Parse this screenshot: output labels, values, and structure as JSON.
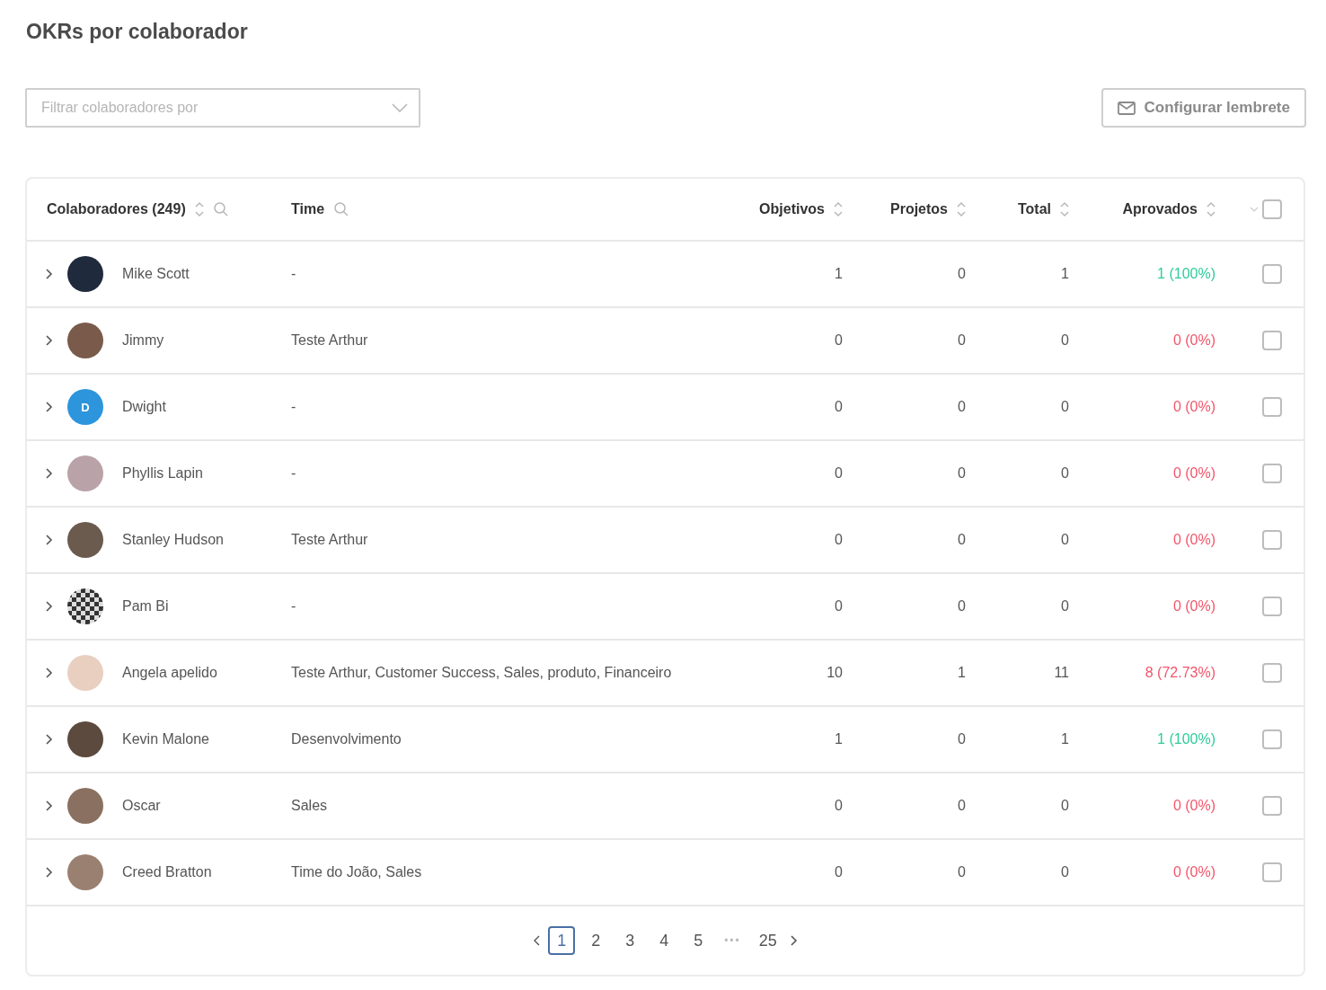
{
  "title": "OKRs por colaborador",
  "filter": {
    "placeholder": "Filtrar colaboradores por"
  },
  "reminder_button": {
    "label": "Configurar lembrete"
  },
  "table": {
    "columns": [
      {
        "label": "Colaboradores (249)",
        "sortable": true,
        "searchable": true
      },
      {
        "label": "Time",
        "sortable": false,
        "searchable": true
      },
      {
        "label": "Objetivos",
        "sortable": true,
        "searchable": false
      },
      {
        "label": "Projetos",
        "sortable": true,
        "searchable": false
      },
      {
        "label": "Total",
        "sortable": true,
        "searchable": false
      },
      {
        "label": "Aprovados",
        "sortable": true,
        "searchable": false
      }
    ],
    "select_all": {
      "checked": false
    },
    "rows": [
      {
        "name": "Mike Scott",
        "avatar": {
          "kind": "photo",
          "color": "#1f2a3c"
        },
        "team": "-",
        "objetivos": "1",
        "projetos": "0",
        "total": "1",
        "aprovados": "1 (100%)",
        "color": "#2ecc9a",
        "expanded": false,
        "checked": false
      },
      {
        "name": "Jimmy",
        "avatar": {
          "kind": "photo",
          "color": "#7a5a4a"
        },
        "team": "Teste Arthur",
        "objetivos": "0",
        "projetos": "0",
        "total": "0",
        "aprovados": "0 (0%)",
        "color": "#f2556a",
        "expanded": false,
        "checked": false
      },
      {
        "name": "Dwight",
        "avatar": {
          "kind": "initial",
          "color": "#2d95dc",
          "initial": "D"
        },
        "team": "-",
        "objetivos": "0",
        "projetos": "0",
        "total": "0",
        "aprovados": "0 (0%)",
        "color": "#f2556a",
        "expanded": false,
        "checked": false
      },
      {
        "name": "Phyllis Lapin",
        "avatar": {
          "kind": "photo",
          "color": "#b9a2a8"
        },
        "team": "-",
        "objetivos": "0",
        "projetos": "0",
        "total": "0",
        "aprovados": "0 (0%)",
        "color": "#f2556a",
        "expanded": false,
        "checked": false
      },
      {
        "name": "Stanley Hudson",
        "avatar": {
          "kind": "photo",
          "color": "#6b5a4e"
        },
        "team": "Teste Arthur",
        "objetivos": "0",
        "projetos": "0",
        "total": "0",
        "aprovados": "0 (0%)",
        "color": "#f2556a",
        "expanded": false,
        "checked": false
      },
      {
        "name": "Pam Bi",
        "avatar": {
          "kind": "pattern",
          "color": "#333333"
        },
        "team": "-",
        "objetivos": "0",
        "projetos": "0",
        "total": "0",
        "aprovados": "0 (0%)",
        "color": "#f2556a",
        "expanded": false,
        "checked": false
      },
      {
        "name": "Angela apelido",
        "avatar": {
          "kind": "photo",
          "color": "#e8cfc0"
        },
        "team": "Teste Arthur, Customer Success, Sales, produto, Financeiro",
        "objetivos": "10",
        "projetos": "1",
        "total": "11",
        "aprovados": "8 (72.73%)",
        "color": "#f2556a",
        "expanded": false,
        "checked": false
      },
      {
        "name": "Kevin Malone",
        "avatar": {
          "kind": "photo",
          "color": "#5c4a3e"
        },
        "team": "Desenvolvimento",
        "objetivos": "1",
        "projetos": "0",
        "total": "1",
        "aprovados": "1 (100%)",
        "color": "#2ecc9a",
        "expanded": false,
        "checked": false
      },
      {
        "name": "Oscar",
        "avatar": {
          "kind": "photo",
          "color": "#8a7060"
        },
        "team": "Sales",
        "objetivos": "0",
        "projetos": "0",
        "total": "0",
        "aprovados": "0 (0%)",
        "color": "#f2556a",
        "expanded": false,
        "checked": false
      },
      {
        "name": "Creed Bratton",
        "avatar": {
          "kind": "photo",
          "color": "#9a8070"
        },
        "team": "Time do João, Sales",
        "objetivos": "0",
        "projetos": "0",
        "total": "0",
        "aprovados": "0 (0%)",
        "color": "#f2556a",
        "expanded": false,
        "checked": false
      }
    ]
  },
  "pagination": {
    "pages": [
      {
        "label": "1",
        "selected": true
      },
      {
        "label": "2",
        "selected": false
      },
      {
        "label": "3",
        "selected": false
      },
      {
        "label": "4",
        "selected": false
      },
      {
        "label": "5",
        "selected": false
      },
      {
        "label": "•••",
        "kind": "ellipsis",
        "selected": false
      },
      {
        "label": "25",
        "selected": false
      }
    ]
  }
}
